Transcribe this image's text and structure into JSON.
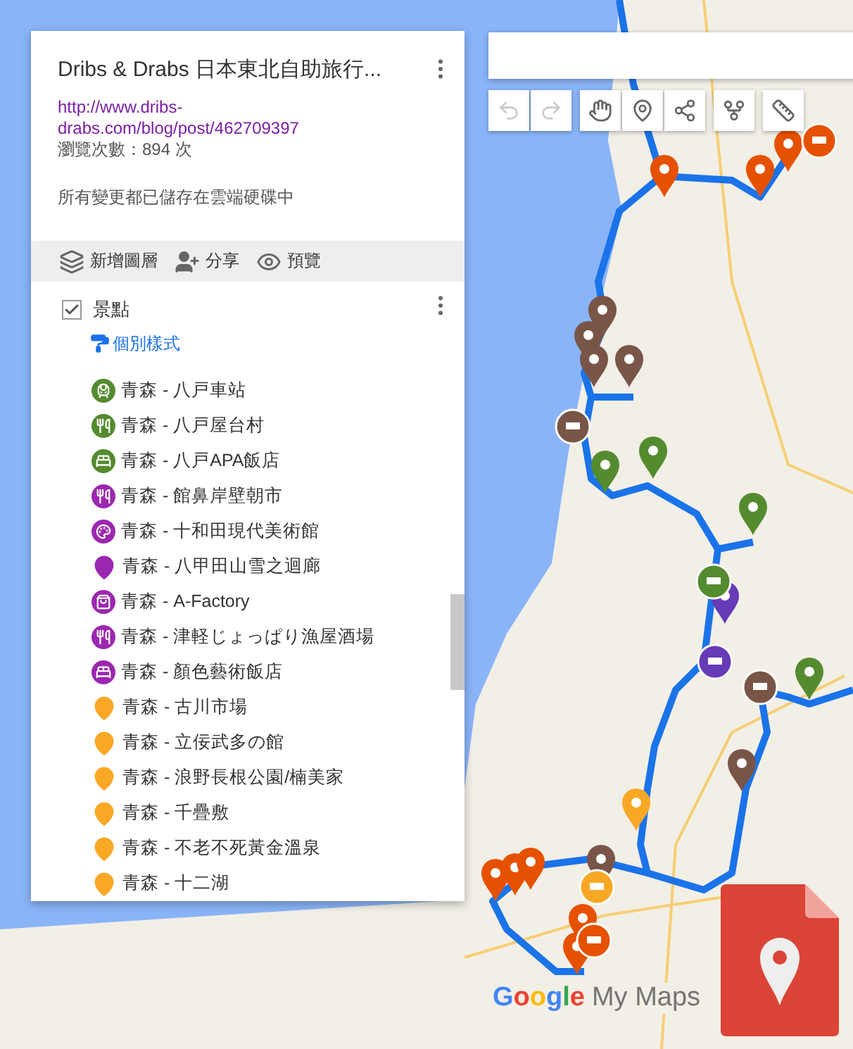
{
  "panel": {
    "title": "Dribs & Drabs 日本東北自助旅行...",
    "link": "http://www.dribs-drabs.com/blog/post/462709397",
    "views": "瀏覽次數：894 次",
    "save_status": "所有變更都已儲存在雲端硬碟中",
    "actions": [
      {
        "kind": "layers",
        "label": "新增圖層"
      },
      {
        "kind": "share",
        "label": "分享"
      },
      {
        "kind": "preview",
        "label": "預覽"
      }
    ],
    "layer": {
      "name": "景點",
      "checked": true,
      "style_link": "個別樣式",
      "items": [
        {
          "kind": "train",
          "color": "#558b2f",
          "label": "青森 - 八戸車站"
        },
        {
          "kind": "restaurant",
          "color": "#558b2f",
          "label": "青森 - 八戸屋台村"
        },
        {
          "kind": "hotel",
          "color": "#558b2f",
          "label": "青森 - 八戸APA飯店"
        },
        {
          "kind": "restaurant",
          "color": "#9c27b0",
          "label": "青森 - 館鼻岸壁朝市"
        },
        {
          "kind": "palette",
          "color": "#9c27b0",
          "label": "青森 - 十和田現代美術館"
        },
        {
          "kind": "pin",
          "color": "#9c27b0",
          "label": "青森 - 八甲田山雪之迴廊"
        },
        {
          "kind": "shop",
          "color": "#9c27b0",
          "label": "青森 - A-Factory"
        },
        {
          "kind": "restaurant",
          "color": "#9c27b0",
          "label": "青森 - 津軽じょっぱり漁屋酒場"
        },
        {
          "kind": "hotel",
          "color": "#9c27b0",
          "label": "青森 - 顏色藝術飯店"
        },
        {
          "kind": "pin",
          "color": "#f9a825",
          "label": "青森 - 古川市場"
        },
        {
          "kind": "pin",
          "color": "#f9a825",
          "label": "青森 - 立佞武多の館"
        },
        {
          "kind": "pin",
          "color": "#f9a825",
          "label": "青森 - 浪野長根公園/楠美家"
        },
        {
          "kind": "pin",
          "color": "#f9a825",
          "label": "青森 - 千疊敷"
        },
        {
          "kind": "pin",
          "color": "#f9a825",
          "label": "青森 - 不老不死黃金溫泉"
        },
        {
          "kind": "pin",
          "color": "#f9a825",
          "label": "青森 - 十二湖"
        }
      ]
    }
  },
  "toolbar": [
    {
      "kind": "undo",
      "disabled": true
    },
    {
      "kind": "redo",
      "disabled": true
    },
    {
      "kind": "hand",
      "disabled": false
    },
    {
      "kind": "marker",
      "disabled": false
    },
    {
      "kind": "line",
      "disabled": false
    },
    {
      "kind": "directions",
      "disabled": false
    },
    {
      "kind": "ruler",
      "disabled": false
    }
  ],
  "logo": {
    "brand": "Google",
    "product": "My Maps"
  }
}
